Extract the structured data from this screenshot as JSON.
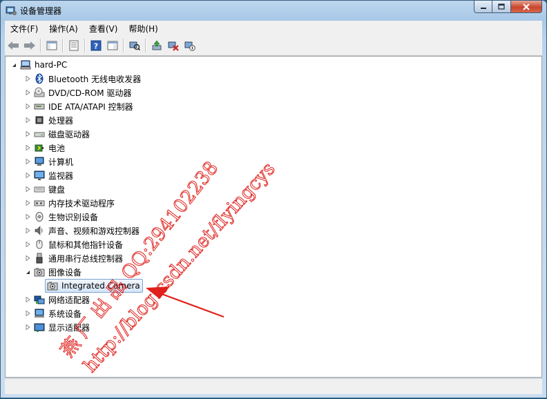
{
  "window": {
    "title": "设备管理器"
  },
  "menu": [
    {
      "label": "文件(F)"
    },
    {
      "label": "操作(A)"
    },
    {
      "label": "查看(V)"
    },
    {
      "label": "帮助(H)"
    }
  ],
  "tree": {
    "root": "hard-PC",
    "items": [
      {
        "label": "Bluetooth 无线电收发器",
        "icon": "bluetooth-icon"
      },
      {
        "label": "DVD/CD-ROM 驱动器",
        "icon": "disc-drive-icon"
      },
      {
        "label": "IDE ATA/ATAPI 控制器",
        "icon": "ide-controller-icon"
      },
      {
        "label": "处理器",
        "icon": "processor-icon"
      },
      {
        "label": "磁盘驱动器",
        "icon": "disk-drive-icon"
      },
      {
        "label": "电池",
        "icon": "battery-icon"
      },
      {
        "label": "计算机",
        "icon": "computer-icon"
      },
      {
        "label": "监视器",
        "icon": "monitor-icon"
      },
      {
        "label": "键盘",
        "icon": "keyboard-icon"
      },
      {
        "label": "内存技术驱动程序",
        "icon": "memory-icon"
      },
      {
        "label": "生物识别设备",
        "icon": "fingerprint-icon"
      },
      {
        "label": "声音、视频和游戏控制器",
        "icon": "speaker-icon"
      },
      {
        "label": "鼠标和其他指针设备",
        "icon": "mouse-icon"
      },
      {
        "label": "通用串行总线控制器",
        "icon": "usb-icon"
      },
      {
        "label": "图像设备",
        "icon": "camera-icon",
        "expanded": true
      },
      {
        "label": "网络适配器",
        "icon": "network-icon"
      },
      {
        "label": "系统设备",
        "icon": "system-device-icon"
      },
      {
        "label": "显示适配器",
        "icon": "display-adapter-icon"
      }
    ],
    "child": {
      "label": "Integrated Camera",
      "icon": "camera-icon"
    }
  },
  "watermark": {
    "line1": "燕 厂 出 品 QQ:294102238",
    "line2": "http://blog.csdn.net/flyingcys",
    "color": "#e0201b"
  }
}
